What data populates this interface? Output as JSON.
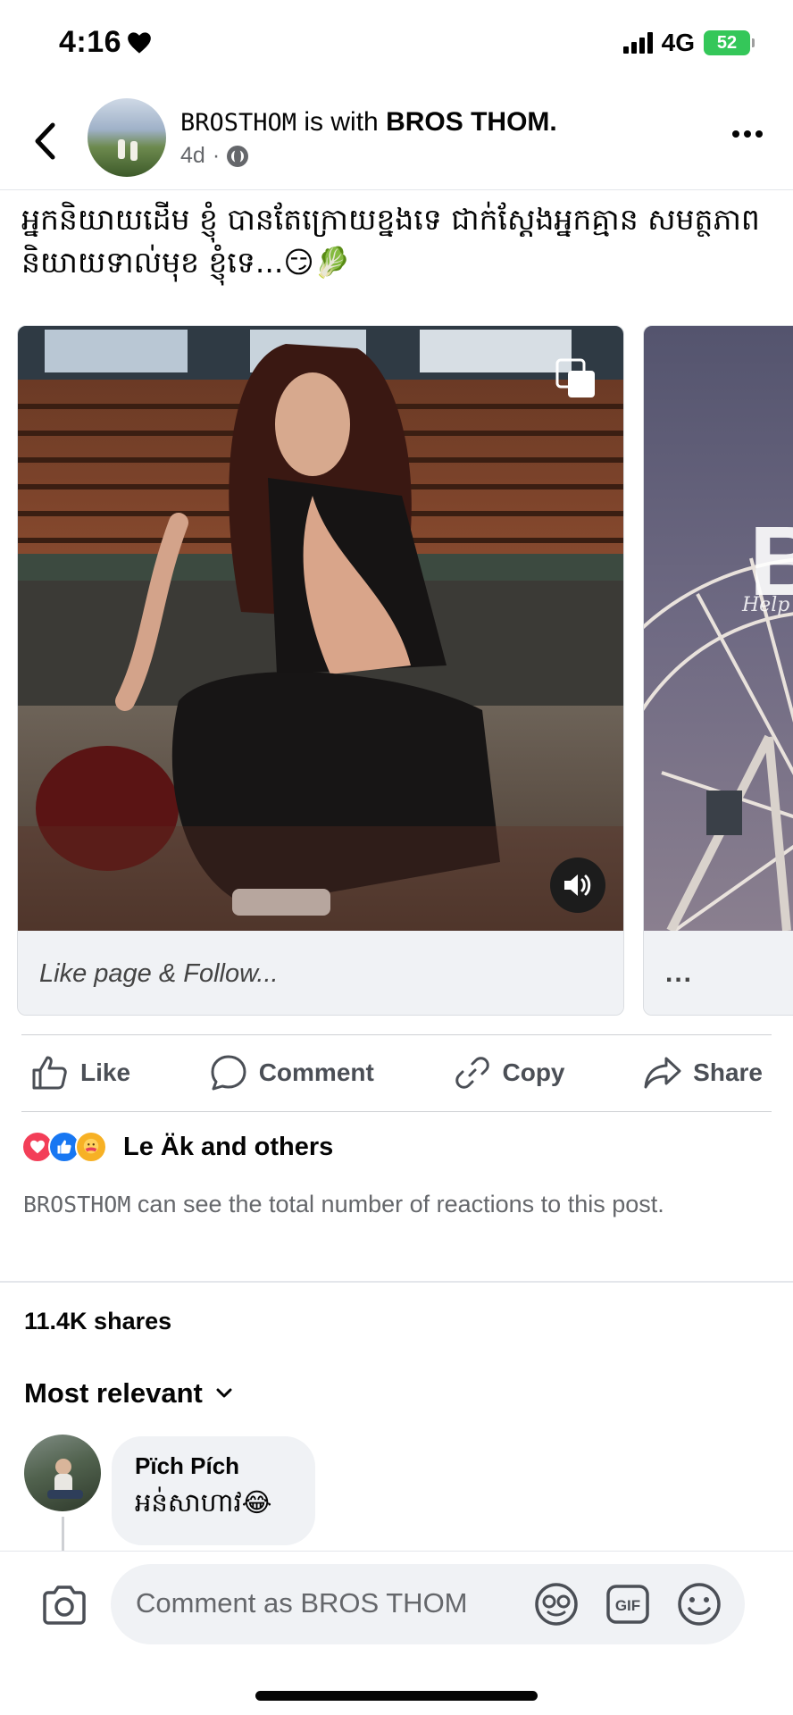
{
  "status_bar": {
    "time": "4:16",
    "network": "4G",
    "battery": "52"
  },
  "header": {
    "page_name": "BROSTHOM",
    "connector": " is with ",
    "tagged_name": "BROS THOM.",
    "time_ago": "4d",
    "separator": "·"
  },
  "caption": "អ្នកនិយាយដើម ខ្ញុំ បានតែក្រោយខ្នងទេ ជាក់ស្តែងអ្នកគ្មាន សមត្ថភាព និយាយទាល់មុខ ខ្ញុំទេ...😏🥬",
  "carousel": {
    "cards": [
      {
        "footer_text": "Like page & Follow..."
      },
      {
        "footer_text": "...",
        "banner_letter": "B",
        "banner_sub": "Help L"
      }
    ]
  },
  "actions": {
    "like": "Like",
    "comment": "Comment",
    "copy": "Copy",
    "share": "Share"
  },
  "reactions": {
    "summary": "Le Äk and others",
    "note_name": "BROSTHOM",
    "note_text": " can see the total number of reactions to this post."
  },
  "shares": "11.4K shares",
  "sort_label": "Most relevant",
  "comments": [
    {
      "author": "Pïch Pích",
      "text": "អន់សាហាវ😂"
    }
  ],
  "composer": {
    "placeholder": "Comment as BROS THOM",
    "gif_label": "GIF"
  },
  "icons": {
    "back": "chevron-left-icon",
    "more": "more-horizontal-icon",
    "globe": "globe-icon",
    "camera": "camera-icon",
    "sticker": "sticker-icon",
    "gif": "gif-icon",
    "emoji": "emoji-icon"
  },
  "colors": {
    "accent": "#1877f2",
    "love": "#f33e58",
    "secondary_text": "#65676b",
    "battery": "#34c759"
  }
}
